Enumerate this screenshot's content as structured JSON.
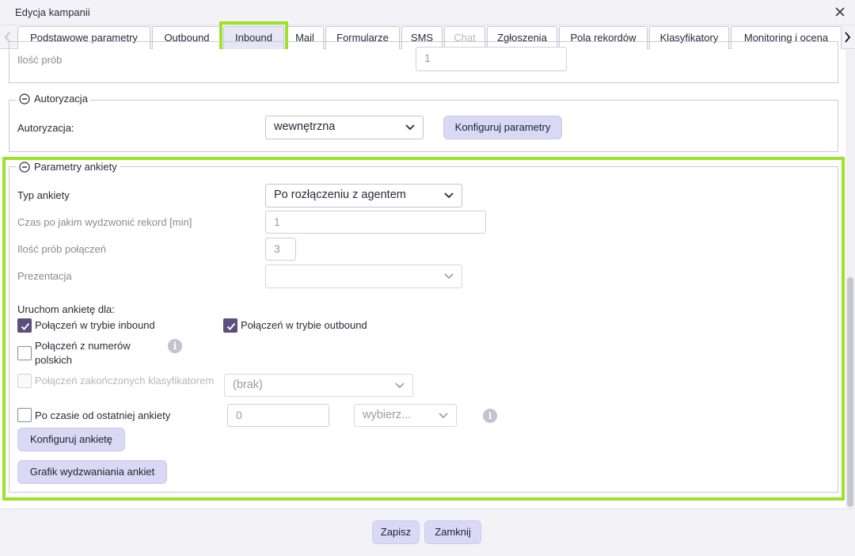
{
  "window": {
    "title": "Edycja kampanii"
  },
  "tabs": [
    {
      "label": "Podstawowe parametry",
      "state": "normal"
    },
    {
      "label": "Outbound",
      "state": "normal"
    },
    {
      "label": "Inbound",
      "state": "active"
    },
    {
      "label": "Mail",
      "state": "normal"
    },
    {
      "label": "Formularze",
      "state": "normal"
    },
    {
      "label": "SMS",
      "state": "normal"
    },
    {
      "label": "Chat",
      "state": "disabled"
    },
    {
      "label": "Zgłoszenia",
      "state": "normal"
    },
    {
      "label": "Pola rekordów",
      "state": "normal"
    },
    {
      "label": "Klasyfikatory",
      "state": "normal"
    },
    {
      "label": "Monitoring i ocena",
      "state": "normal"
    }
  ],
  "top_section": {
    "attempts_label": "Ilość prób",
    "attempts_value": "1"
  },
  "auth": {
    "legend": "Autoryzacja",
    "label": "Autoryzacja:",
    "value": "wewnętrzna",
    "config_button": "Konfiguruj parametry"
  },
  "survey": {
    "legend": "Parametry ankiety",
    "type_label": "Typ ankiety",
    "type_value": "Po rozłączeniu z agentem",
    "callback_label": "Czas po jakim wydzwonić rekord [min]",
    "callback_value": "1",
    "attempts_label": "Ilość prób połączeń",
    "attempts_value": "3",
    "presentation_label": "Prezentacja",
    "presentation_value": "",
    "run_for_label": "Uruchom ankietę dla:",
    "inbound_label": "Połączeń w trybie inbound",
    "inbound_checked": true,
    "outbound_label": "Połączeń w trybie outbound",
    "outbound_checked": true,
    "polish_label_line1": "Połączeń z numerów",
    "polish_label_line2": "polskich",
    "polish_checked": false,
    "classifier_label": "Połączeń zakończonych klasyfikatorem",
    "classifier_value": "(brak)",
    "classifier_checked": false,
    "after_time_label": "Po czasie od ostatniej ankiety",
    "after_time_value": "0",
    "after_time_unit": "wybierz...",
    "after_time_checked": false,
    "configure_button": "Konfiguruj ankietę",
    "schedule_button": "Grafik wydzwaniania ankiet"
  },
  "footer": {
    "save_label": "Zapisz",
    "close_label": "Zamknij"
  },
  "colors": {
    "highlight": "#9be327",
    "accent": "#5b4f7d",
    "button_bg": "#d9d9f5"
  }
}
